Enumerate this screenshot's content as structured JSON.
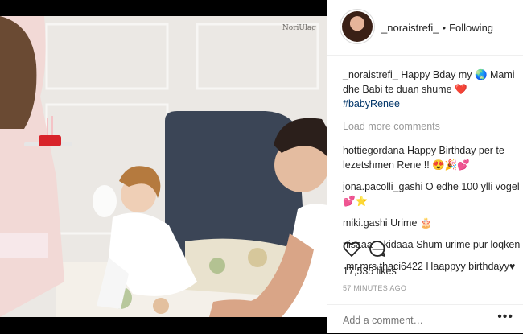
{
  "post": {
    "photo_watermark": "NoriUlag",
    "author": "_noraistrefi_",
    "follow_status": "Following",
    "caption": {
      "user": "_noraistrefi_",
      "text": "Happy Bday my 🌏 Mami dhe Babi te duan shume ❤️",
      "hashtag": "#babyRenee"
    },
    "load_more": "Load more comments",
    "comments": [
      {
        "user": "hottiegordana",
        "text": "Happy Birthday per te lezetshmen Rene !! 😍🎉💕"
      },
      {
        "user": "jona.pacolli_gashi",
        "text": "O edhe 100 ylli vogel 💕⭐"
      },
      {
        "user": "miki.gashi",
        "text": "Urime 🎂"
      },
      {
        "user": "nisaaa__kidaaa",
        "text": "Shum urime pur loqken"
      },
      {
        "user": "mr.mrs.thaci6422",
        "text": "Haappyy birthdayy♥"
      }
    ],
    "likes": "17,535 likes",
    "time": "57 MINUTES AGO",
    "add_comment_placeholder": "Add a comment…",
    "more_options": "•••"
  },
  "icons": {
    "like": "heart-outline-icon",
    "comment": "comment-bubble-icon",
    "more": "more-dots-icon"
  },
  "colors": {
    "hashtag": "#003569",
    "muted": "#999999",
    "text": "#262626"
  }
}
